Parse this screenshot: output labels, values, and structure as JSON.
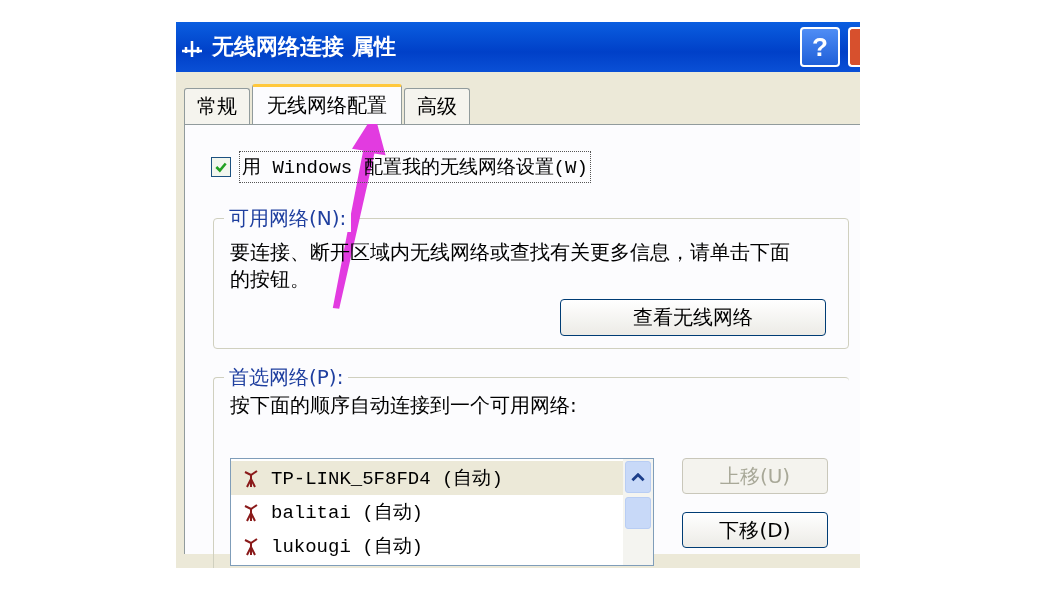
{
  "window": {
    "title": "无线网络连接 属性",
    "help_button": "?"
  },
  "tabs": [
    {
      "label": "常规",
      "selected": false
    },
    {
      "label": "无线网络配置",
      "selected": true
    },
    {
      "label": "高级",
      "selected": false
    }
  ],
  "use_windows_checkbox": {
    "label": "用 Windows 配置我的无线网络设置(W)",
    "checked": true
  },
  "available_networks": {
    "title": "可用网络(N):",
    "description": "要连接、断开区域内无线网络或查找有关更多信息，请单击下面的按钮。",
    "button": "查看无线网络"
  },
  "preferred_networks": {
    "title": "首选网络(P):",
    "description": "按下面的顺序自动连接到一个可用网络:",
    "networks": [
      {
        "name": "TP-LINK_5F8FD4 (自动)",
        "selected": true
      },
      {
        "name": "balitai (自动)",
        "selected": false
      },
      {
        "name": "lukougi (自动)",
        "selected": false
      }
    ],
    "buttons": [
      {
        "label": "上移(U)",
        "disabled": true
      },
      {
        "label": "下移(D)",
        "disabled": false
      }
    ]
  }
}
